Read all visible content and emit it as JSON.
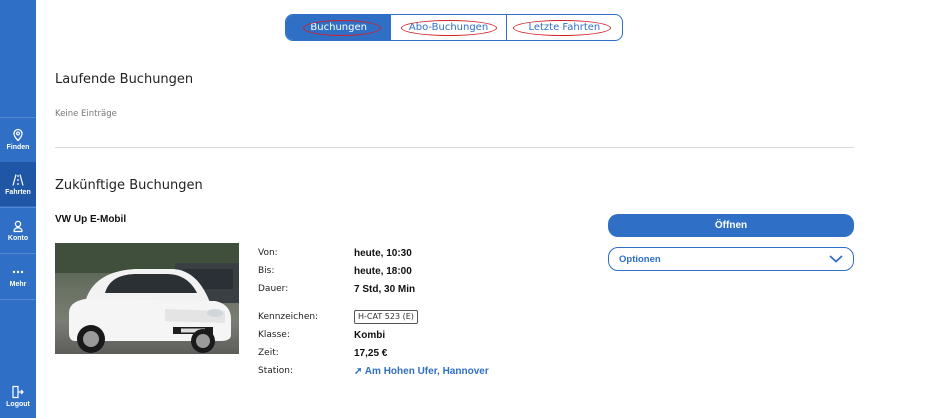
{
  "sidebar": {
    "items": [
      {
        "label": "Finden",
        "icon": "location-pin-icon"
      },
      {
        "label": "Fahrten",
        "icon": "road-icon",
        "active": true
      },
      {
        "label": "Konto",
        "icon": "user-icon"
      },
      {
        "label": "Mehr",
        "icon": "more-dots-icon"
      },
      {
        "label": "Logout",
        "icon": "logout-icon"
      }
    ]
  },
  "tabs": [
    "Buchungen",
    "Abo-Buchungen",
    "Letzte Fahrten"
  ],
  "current": {
    "title": "Laufende Buchungen",
    "empty_text": "Keine Einträge"
  },
  "upcoming": {
    "title": "Zukünftige Buchungen",
    "booking": {
      "car_name": "VW Up E-Mobil",
      "fields": {
        "von_label": "Von:",
        "von": "heute, 10:30",
        "bis_label": "Bis:",
        "bis": "heute, 18:00",
        "dauer_label": "Dauer:",
        "dauer": "7 Std, 30 Min",
        "kennzeichen_label": "Kennzeichen:",
        "kennzeichen": "H-CAT 523 (E)",
        "klasse_label": "Klasse:",
        "klasse": "Kombi",
        "zeit_label": "Zeit:",
        "zeit": "17,25 €",
        "station_label": "Station:",
        "station": "Am Hohen Ufer, Hannover"
      },
      "open_label": "Öffnen",
      "options_label": "Optionen"
    }
  },
  "colors": {
    "primary": "#2f6fc6",
    "sidebar_active": "#1f57a6",
    "highlight_oval": "#d0202a"
  }
}
